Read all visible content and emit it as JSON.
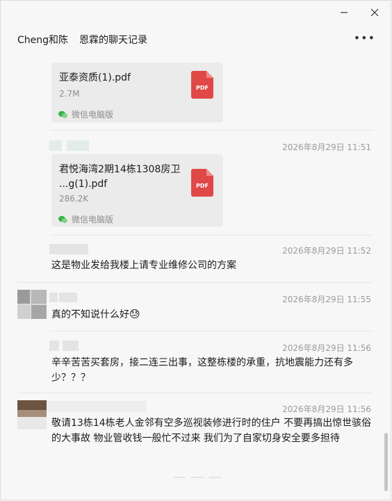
{
  "window": {
    "chat_with": "Cheng和陈",
    "history_title": "恩霖的聊天记录",
    "more_label": "•••"
  },
  "messages": [
    {
      "file": {
        "name_line1": "亚泰资质(1).pdf",
        "name_line2": "",
        "size": "2.7M",
        "source": "微信电脑版",
        "icon_text": "PDF"
      }
    },
    {
      "time": "2026年8月29日 11:51",
      "file": {
        "name_line1": "君悦海湾2期14栋1308房卫",
        "name_line2": "...g(1).pdf",
        "size": "286.2K",
        "source": "微信电脑版",
        "icon_text": "PDF"
      }
    },
    {
      "time": "2026年8月29日 11:52",
      "text": "这是物业发给我楼上请专业维修公司的方案"
    },
    {
      "time": "2026年8月29日 11:55",
      "text": "真的不知说什么好",
      "emoji": "😓"
    },
    {
      "time": "2026年8月29日 11:56",
      "text": "辛辛苦苦买套房，接二连三出事，这整栋楼的承重，抗地震能力还有多少？？？"
    },
    {
      "time": "2026年8月29日 11:56",
      "text": "敬请13栋14栋老人金邻有空多巡视装修进行时的住户 不要再搞出惊世骇俗的大事故 物业管收钱一般忙不过来 我们为了自家切身安全要多担待"
    }
  ],
  "colors": {
    "pdf_red": "#e04848",
    "wechat_green": "#3cb24a",
    "time_gray": "#9a9a9a"
  }
}
